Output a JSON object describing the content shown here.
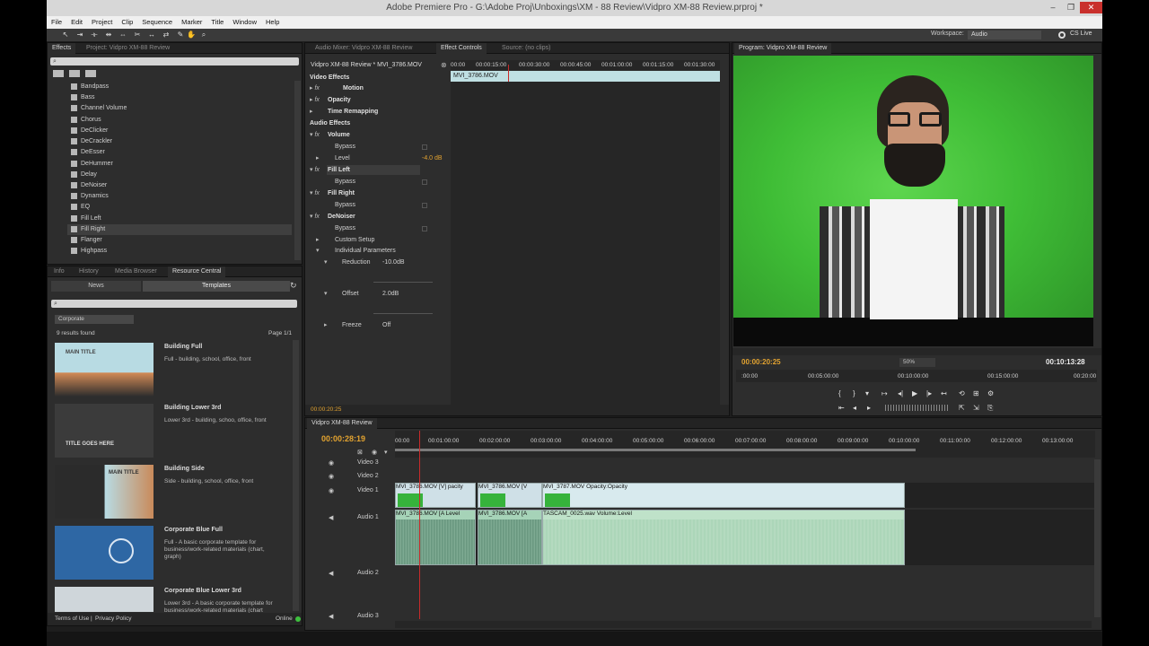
{
  "window": {
    "title": "Adobe Premiere Pro - G:\\Adobe Proj\\Unboxings\\XM - 88 Review\\Vidpro XM-88 Review.prproj *",
    "min": "–",
    "max": "❐",
    "close": "✕"
  },
  "menu": [
    "File",
    "Edit",
    "Project",
    "Clip",
    "Sequence",
    "Marker",
    "Title",
    "Window",
    "Help"
  ],
  "toolbar": {
    "workspace_label": "Workspace:",
    "workspace_value": "Audio",
    "cslive": "CS Live"
  },
  "effects_panel": {
    "tabs": [
      "Effects",
      "Project: Vidpro XM-88 Review"
    ],
    "items": [
      "Bandpass",
      "Bass",
      "Channel Volume",
      "Chorus",
      "DeClicker",
      "DeCrackler",
      "DeEsser",
      "DeHummer",
      "Delay",
      "DeNoiser",
      "Dynamics",
      "EQ",
      "Fill Left",
      "Fill Right",
      "Flanger",
      "Highpass"
    ]
  },
  "resource_panel": {
    "tabs": [
      "Info",
      "History",
      "Media Browser",
      "Resource Central"
    ],
    "subtabs": [
      "News",
      "Templates"
    ],
    "category": "Corporate",
    "results": "9 results found",
    "page": "Page 1/1",
    "templates": [
      {
        "name": "Building Full",
        "desc": "Full - building, school, office, front",
        "thumb_text": "MAIN TITLE"
      },
      {
        "name": "Building Lower 3rd",
        "desc": "Lower 3rd - building, schoo, office, front",
        "thumb_text": "TITLE GOES HERE"
      },
      {
        "name": "Building Side",
        "desc": "Side - building, school, office, front",
        "thumb_text": "MAIN TITLE"
      },
      {
        "name": "Corporate Blue Full",
        "desc": "Full - A basic corporate template for business/work-related materials (chart, graph)",
        "thumb_text": ""
      },
      {
        "name": "Corporate Blue Lower 3rd",
        "desc": "Lower 3rd - A basic corporate template for business/work-related materials (chart",
        "thumb_text": ""
      }
    ],
    "footer_terms": "Terms of Use",
    "footer_privacy": "Privacy Policy",
    "footer_status": "Online"
  },
  "effect_controls": {
    "tabs": [
      "Audio Mixer: Vidpro XM-88 Review",
      "Effect Controls",
      "Source: (no clips)"
    ],
    "clip_header": "Vidpro XM-88 Review * MVI_3786.MOV",
    "clip_bar": "MVI_3786.MOV",
    "ruler": [
      "00:00",
      "00:00:15:00",
      "00:00:30:00",
      "00:00:45:00",
      "00:01:00:00",
      "00:01:15:00",
      "00:01:30:00"
    ],
    "video_effects": "Video Effects",
    "motion": "Motion",
    "opacity": "Opacity",
    "time_remap": "Time Remapping",
    "audio_effects": "Audio Effects",
    "volume": "Volume",
    "bypass": "Bypass",
    "level": "Level",
    "level_val": "-4.0 dB",
    "fill_left": "Fill Left",
    "fill_right": "Fill Right",
    "denoiser": "DeNoiser",
    "custom_setup": "Custom Setup",
    "individual": "Individual Parameters",
    "reduction": "Reduction",
    "reduction_val": "-10.0dB",
    "offset": "Offset",
    "offset_val": "2.0dB",
    "freeze": "Freeze",
    "freeze_val": "Off",
    "timecode": "00:00:20:25"
  },
  "program": {
    "tab": "Program: Vidpro XM-88 Review",
    "tc_current": "00:00:20:25",
    "tc_duration": "00:10:13:28",
    "zoom": "50%",
    "ruler": [
      ":00:00",
      "00:05:00:00",
      "00:10:00:00",
      "00:15:00:00",
      "00:20:00"
    ]
  },
  "timeline": {
    "tab": "Vidpro XM-88 Review",
    "timecode": "00:00:28:19",
    "ruler": [
      "00:00",
      "00:01:00:00",
      "00:02:00:00",
      "00:03:00:00",
      "00:04:00:00",
      "00:05:00:00",
      "00:06:00:00",
      "00:07:00:00",
      "00:08:00:00",
      "00:09:00:00",
      "00:10:00:00",
      "00:11:00:00",
      "00:12:00:00",
      "00:13:00:00"
    ],
    "tracks": {
      "v3": "Video 3",
      "v2": "Video 2",
      "v1": "Video 1",
      "a1": "Audio 1",
      "a2": "Audio 2",
      "a3": "Audio 3"
    },
    "clips": {
      "v_a": "MVI_3786.MOV [V]",
      "v_a_fx": "pacity",
      "v_b": "MVI_3786.MOV [V",
      "v_c": "MVI_3787.MOV",
      "v_c_fx": "Opacity:Opacity",
      "a_a": "MVI_3786.MOV [A",
      "a_a_fx": "Level",
      "a_b": "MVI_3786.MOV [A",
      "a_c": "TASCAM_0025.wav",
      "a_c_fx": "Volume:Level"
    }
  }
}
